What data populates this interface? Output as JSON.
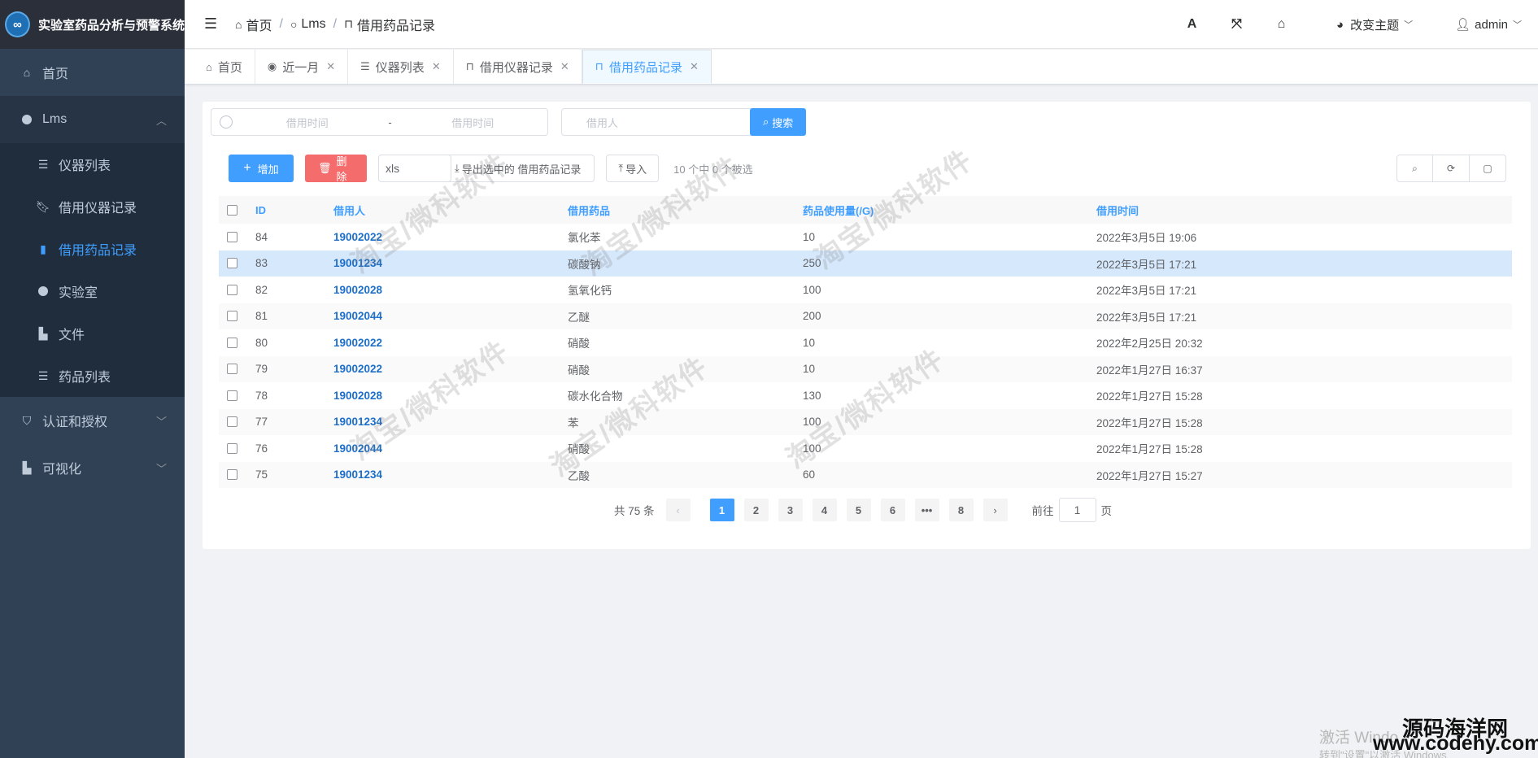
{
  "brand": {
    "title": "实验室药品分析与预警系统",
    "logo": "∞"
  },
  "sidebar": {
    "items": [
      {
        "label": "首页",
        "icon": "home-icon"
      },
      {
        "label": "Lms",
        "icon": "circle-icon",
        "expanded": true
      },
      {
        "label": "认证和授权",
        "icon": "shield-icon"
      },
      {
        "label": "可视化",
        "icon": "file-icon"
      }
    ],
    "sub": [
      {
        "label": "仪器列表",
        "icon": "list-icon"
      },
      {
        "label": "借用仪器记录",
        "icon": "bookmark-icon"
      },
      {
        "label": "借用药品记录",
        "icon": "bookmark-icon",
        "active": true
      },
      {
        "label": "实验室",
        "icon": "circle-icon"
      },
      {
        "label": "文件",
        "icon": "file-icon"
      },
      {
        "label": "药品列表",
        "icon": "list-icon"
      }
    ]
  },
  "header": {
    "breadcrumb": [
      "首页",
      "Lms",
      "借用药品记录"
    ],
    "theme_label": "改变主题",
    "user": "admin"
  },
  "tags": [
    "首页",
    "近一月",
    "仪器列表",
    "借用仪器记录",
    "借用药品记录"
  ],
  "search": {
    "start_placeholder": "借用时间",
    "range_sep": "-",
    "end_placeholder": "借用时间",
    "user_placeholder": "借用人",
    "button": "搜索"
  },
  "toolbar": {
    "add": "增加",
    "delete": "删除",
    "export_type": "xls",
    "export": "导出选中的 借用药品记录",
    "import": "导入",
    "selection_info": "10 个中 0 个被选"
  },
  "table": {
    "headers": [
      "ID",
      "借用人",
      "借用药品",
      "药品使用量(/G)",
      "借用时间"
    ],
    "rows": [
      [
        "84",
        "19002022",
        "氯化苯",
        "10",
        "2022年3月5日 19:06"
      ],
      [
        "83",
        "19001234",
        "碳酸钠",
        "250",
        "2022年3月5日 17:21"
      ],
      [
        "82",
        "19002028",
        "氢氧化钙",
        "100",
        "2022年3月5日 17:21"
      ],
      [
        "81",
        "19002044",
        "乙醚",
        "200",
        "2022年3月5日 17:21"
      ],
      [
        "80",
        "19002022",
        "硝酸",
        "10",
        "2022年2月25日 20:32"
      ],
      [
        "79",
        "19002022",
        "硝酸",
        "10",
        "2022年1月27日 16:37"
      ],
      [
        "78",
        "19002028",
        "碳水化合物",
        "130",
        "2022年1月27日 15:28"
      ],
      [
        "77",
        "19001234",
        "苯",
        "100",
        "2022年1月27日 15:28"
      ],
      [
        "76",
        "19002044",
        "硝酸",
        "100",
        "2022年1月27日 15:28"
      ],
      [
        "75",
        "19001234",
        "乙酸",
        "60",
        "2022年1月27日 15:27"
      ]
    ]
  },
  "pagination": {
    "total": "共 75 条",
    "pages": [
      "1",
      "2",
      "3",
      "4",
      "5",
      "6",
      "•••",
      "8"
    ],
    "current": "1",
    "goto_prefix": "前往",
    "goto_value": "1",
    "goto_suffix": "页"
  },
  "watermark": "淘宝/微科软件",
  "overlay": {
    "activation_line1": "激活 Windo",
    "activation_line2": "转到\"设置\"以激活 Windows",
    "site_name": "源码海洋网",
    "site_url": "www.codehy.com"
  },
  "colors": {
    "primary": "#409eff",
    "danger": "#f56c6c",
    "sidebar": "#304156"
  }
}
